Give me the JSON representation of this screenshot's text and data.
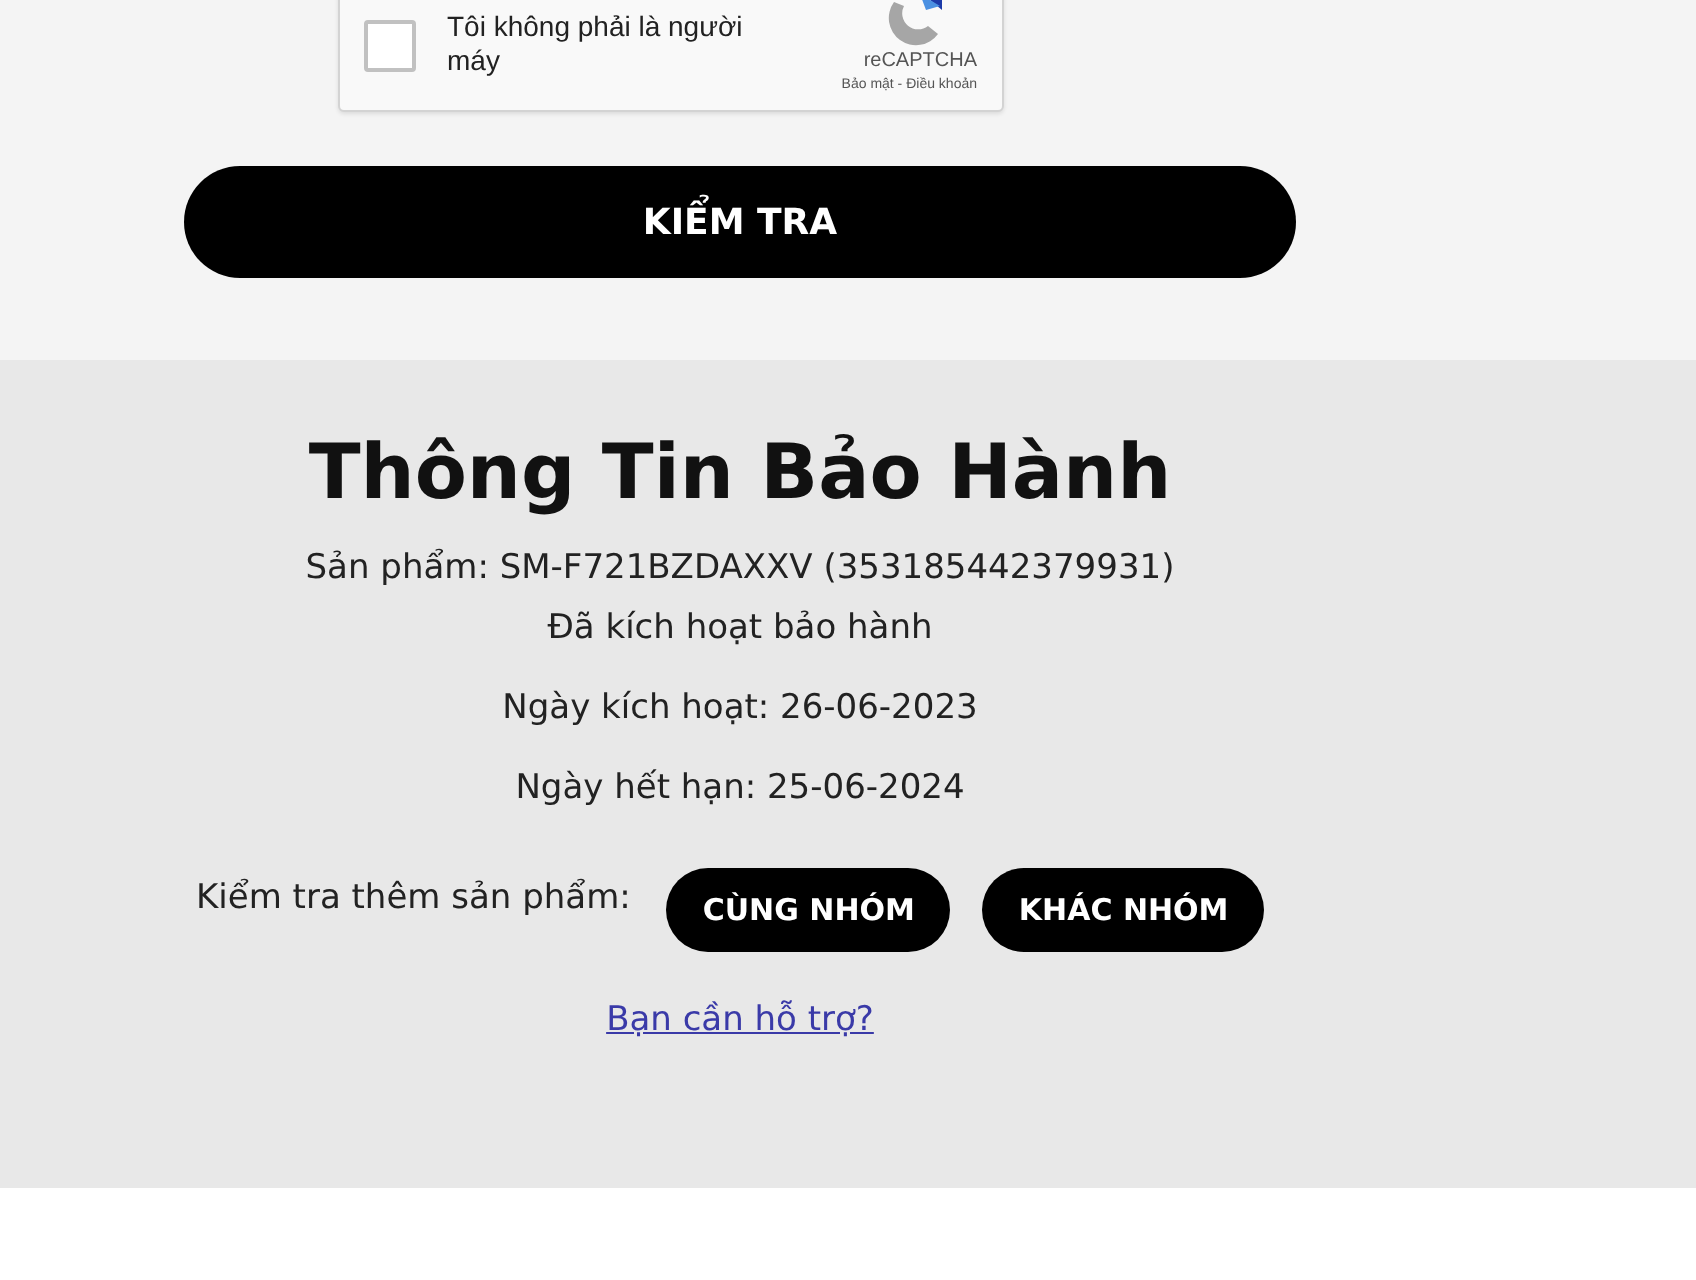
{
  "captcha": {
    "label": "Tôi không phải là người máy",
    "checked": false,
    "brand": "reCAPTCHA",
    "links": "Bảo mật - Điều khoản"
  },
  "check_button": "KIỂM TRA",
  "warranty": {
    "title": "Thông Tin Bảo Hành",
    "product": "Sản phẩm: SM-F721BZDAXXV (353185442379931)",
    "status": "Đã kích hoạt bảo hành",
    "activation": "Ngày kích hoạt: 26-06-2023",
    "expiry": "Ngày hết hạn: 25-06-2024",
    "more_label": "Kiểm tra thêm sản phẩm:",
    "buttons": [
      "CÙNG NHÓM",
      "KHÁC NHÓM"
    ],
    "help_link": "Bạn cần hỗ trợ?"
  }
}
